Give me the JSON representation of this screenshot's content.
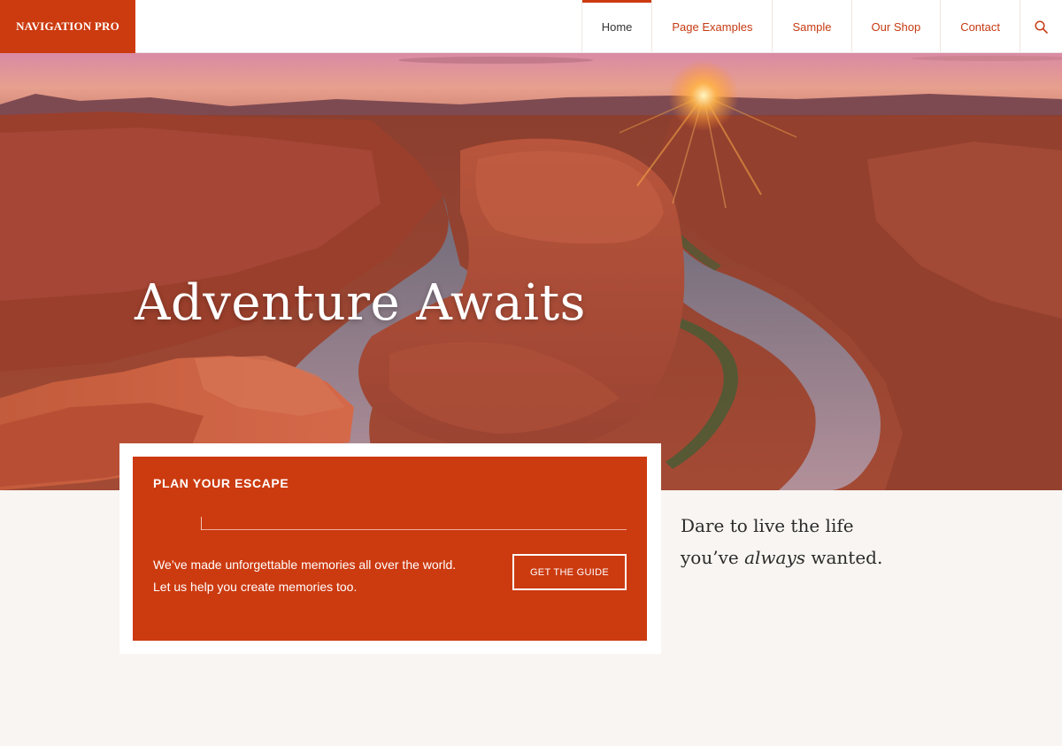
{
  "header": {
    "logo": "NAVIGATION PRO",
    "nav": [
      {
        "label": "Home",
        "active": true
      },
      {
        "label": "Page Examples",
        "active": false
      },
      {
        "label": "Sample",
        "active": false
      },
      {
        "label": "Our Shop",
        "active": false
      },
      {
        "label": "Contact",
        "active": false
      }
    ],
    "search_icon": "search-icon"
  },
  "hero": {
    "title": "Adventure Awaits",
    "image": "canyon-sunset-photo"
  },
  "card": {
    "title": "PLAN YOUR ESCAPE",
    "text_line1": "We’ve made unforgettable memories all over the world.",
    "text_line2": "Let us help you create memories too.",
    "button": "GET THE GUIDE"
  },
  "tagline": {
    "line1": "Dare to live the life",
    "line2_pre": "you’ve ",
    "line2_em": "always",
    "line2_post": " wanted."
  },
  "colors": {
    "accent": "#cc3a0f",
    "background": "#f8f5f2"
  }
}
